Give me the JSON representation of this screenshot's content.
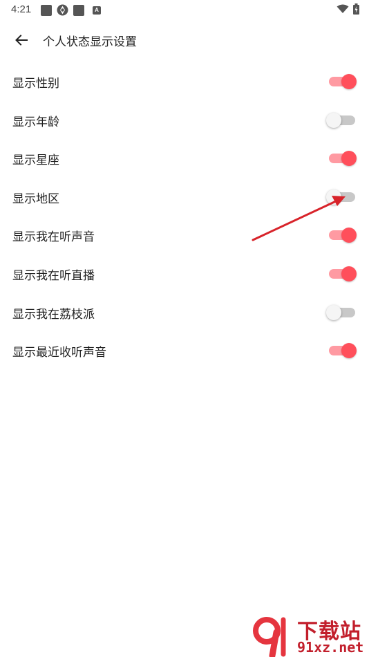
{
  "status_bar": {
    "time": "4:21"
  },
  "header": {
    "title": "个人状态显示设置"
  },
  "settings": [
    {
      "label": "显示性别",
      "enabled": true
    },
    {
      "label": "显示年龄",
      "enabled": false
    },
    {
      "label": "显示星座",
      "enabled": true
    },
    {
      "label": "显示地区",
      "enabled": false
    },
    {
      "label": "显示我在听声音",
      "enabled": true
    },
    {
      "label": "显示我在听直播",
      "enabled": true
    },
    {
      "label": "显示我在荔枝派",
      "enabled": false
    },
    {
      "label": "显示最近收听声音",
      "enabled": true
    }
  ],
  "watermark": {
    "line1": "下载站",
    "line2": "91xz.net"
  },
  "colors": {
    "accent": "#ff4f5b",
    "accent_track": "#ff9aa2",
    "off_track": "#c8c8c8",
    "annotation": "#d8232a"
  }
}
